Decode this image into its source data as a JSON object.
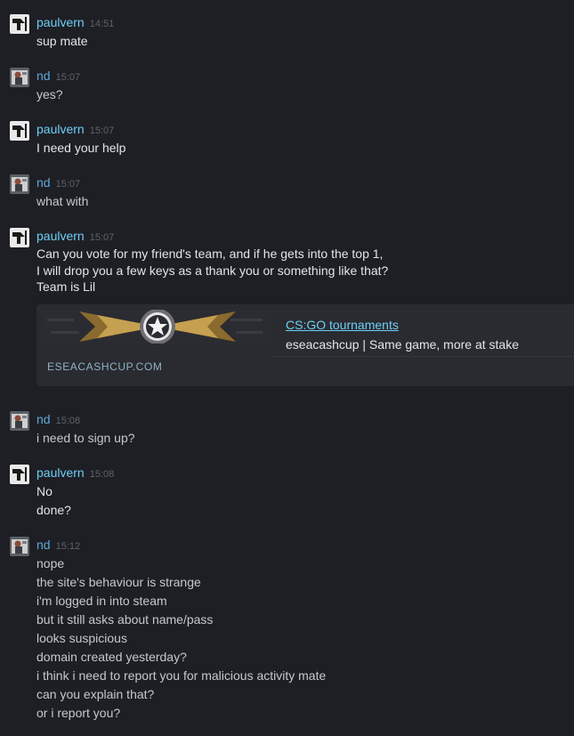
{
  "messages": [
    {
      "author": "paulvern",
      "time": "14:51",
      "lines": [
        "sup mate"
      ]
    },
    {
      "author": "nd",
      "time": "15:07",
      "lines": [
        "yes?"
      ]
    },
    {
      "author": "paulvern",
      "time": "15:07",
      "lines": [
        "I need your help"
      ]
    },
    {
      "author": "nd",
      "time": "15:07",
      "lines": [
        "what with"
      ]
    },
    {
      "author": "paulvern",
      "time": "15:07",
      "lines": [
        "Can you vote for my friend's team, and if he gets into the top 1,",
        "I will drop you a few keys as a thank you or something like that?",
        "Team is Lil"
      ],
      "embed": {
        "title": "CS:GO tournaments",
        "description": "eseacashcup | Same game, more at stake",
        "domain": "ESEACASHCUP.COM"
      }
    },
    {
      "author": "nd",
      "time": "15:08",
      "lines": [
        "i need to sign up?"
      ]
    },
    {
      "author": "paulvern",
      "time": "15:08",
      "lines": [
        "No",
        "done?"
      ]
    },
    {
      "author": "nd",
      "time": "15:12",
      "lines": [
        "nope",
        "the site's behaviour is strange",
        "i'm logged in into steam",
        "but it still asks about name/pass",
        "looks suspicious",
        "domain created yesterday?",
        "i think i need to report you for malicious activity mate",
        "can you explain that?",
        "or i report you?"
      ]
    }
  ],
  "icons": {
    "paulvern_avatar": "paulvern-avatar-icon",
    "nd_avatar": "nd-avatar-icon",
    "embed_banner": "csgo-emblem-icon"
  },
  "colors": {
    "background": "#1e1f25",
    "username": "#6dcff6",
    "timestamp": "#5d636b",
    "text": "#e3e5e8",
    "embed_bg": "#2a2b30"
  }
}
